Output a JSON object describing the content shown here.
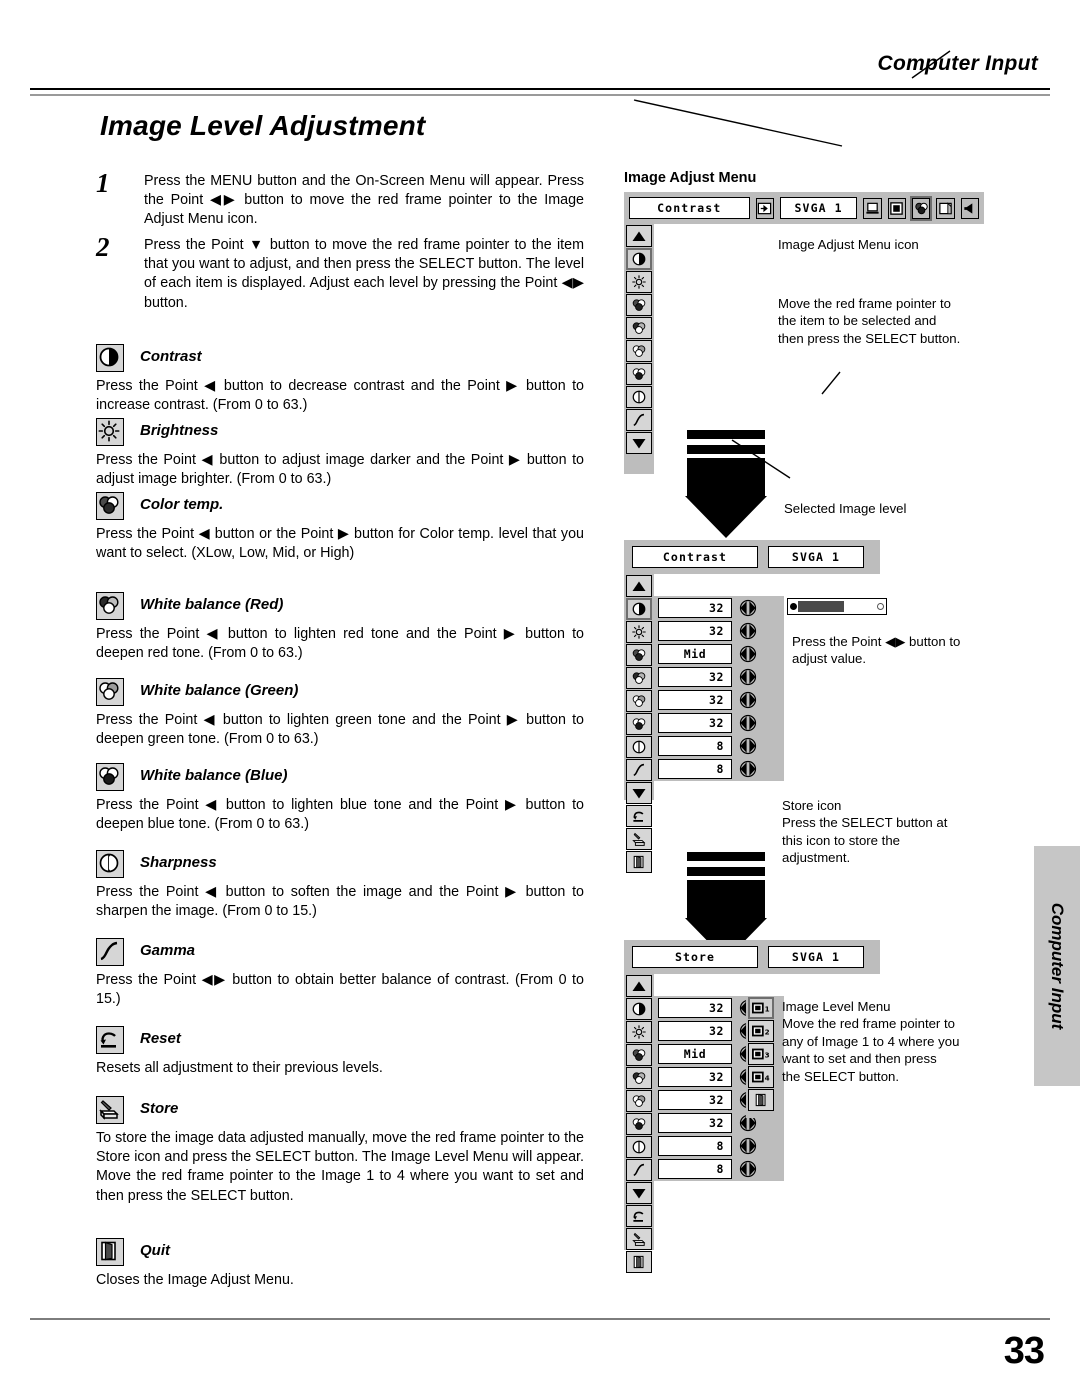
{
  "header": {
    "section_title": "Computer Input",
    "page_number": "33"
  },
  "side_tab": {
    "label": "Computer Input"
  },
  "page_title": "Image Level Adjustment",
  "steps": [
    {
      "number": "1",
      "text": "Press the MENU button and the On-Screen Menu will appear.  Press the Point ◀▶ button to move the red frame pointer to the Image Adjust Menu icon."
    },
    {
      "number": "2",
      "text": "Press the Point ▼ button to move the red frame pointer to the item that you want to adjust, and then press the SELECT button.  The level of each item is displayed.  Adjust each level by pressing the Point ◀▶ button."
    }
  ],
  "items": [
    {
      "icon": "contrast-icon",
      "label": "Contrast",
      "description": "Press the Point ◀ button to decrease contrast and the Point ▶ button to increase contrast.  (From 0 to 63.)"
    },
    {
      "icon": "brightness-icon",
      "label": "Brightness",
      "description": "Press the Point ◀ button to adjust image darker and the Point ▶ button to adjust image brighter.  (From 0 to 63.)"
    },
    {
      "icon": "color-temp-icon",
      "label": "Color temp.",
      "description": "Press the Point ◀ button or the Point ▶ button for Color temp. level that you want to select. (XLow, Low, Mid, or High)"
    },
    {
      "icon": "white-balance-red-icon",
      "label": "White balance (Red)",
      "description": "Press the Point ◀ button to lighten red tone and the Point ▶ button to deepen red tone.  (From 0 to 63.)"
    },
    {
      "icon": "white-balance-green-icon",
      "label": "White balance (Green)",
      "description": "Press the Point ◀ button to lighten green tone and the Point ▶ button to deepen green tone.  (From 0 to 63.)"
    },
    {
      "icon": "white-balance-blue-icon",
      "label": "White balance (Blue)",
      "description": "Press the Point ◀ button to lighten blue tone and the Point ▶ button to deepen blue tone.  (From 0 to 63.)"
    },
    {
      "icon": "sharpness-icon",
      "label": "Sharpness",
      "description": "Press the Point ◀ button to soften the image and the Point ▶ button to sharpen the image.  (From 0 to 15.)"
    },
    {
      "icon": "gamma-icon",
      "label": "Gamma",
      "description": "Press the Point ◀▶ button to obtain better balance of contrast. (From 0 to 15.)"
    },
    {
      "icon": "reset-icon",
      "label": "Reset",
      "description": "Resets all adjustment to their previous levels."
    },
    {
      "icon": "store-icon",
      "label": "Store",
      "description": "To store the image data adjusted manually, move the red frame pointer to the Store icon and press the SELECT button.  The Image Level Menu will appear.  Move the red frame pointer to the Image 1 to 4 where you want to set and then press the SELECT button."
    },
    {
      "icon": "quit-icon",
      "label": "Quit",
      "description": "Closes the Image Adjust Menu."
    }
  ],
  "diagram": {
    "title": "Image Adjust Menu",
    "menu1": {
      "title_field": "Contrast",
      "source_field": "SVGA 1",
      "toolbar_icons": [
        "input-icon",
        "computer-icon",
        "screen-icon",
        "image-adjust-icon",
        "pc-adjust-icon",
        "sound-icon"
      ],
      "selected_toolbar_icon": "image-adjust-icon",
      "icon_rows": [
        "scroll-up-icon",
        "contrast-icon",
        "brightness-icon",
        "color-temp-icon",
        "white-balance-red-icon",
        "white-balance-green-icon",
        "white-balance-blue-icon",
        "sharpness-icon",
        "gamma-icon",
        "scroll-down-icon"
      ],
      "highlighted_row": "contrast-icon",
      "callout_menu_icon": "Image Adjust Menu icon",
      "callout_pointer": "Move the red frame pointer to\nthe item to be selected and\nthen press the SELECT button."
    },
    "menu2": {
      "title_field": "Contrast",
      "source_field": "SVGA 1",
      "callout_level": "Selected Image level",
      "callout_adjust": "Press the Point ◀▶ button to\nadjust value.",
      "callout_store": "Store icon\nPress the SELECT button at\nthis icon to store the\nadjustment.",
      "slider": {
        "value_percent": 52
      },
      "rows": [
        {
          "icon": "contrast-icon",
          "value": "32",
          "centered": false
        },
        {
          "icon": "brightness-icon",
          "value": "32",
          "centered": false
        },
        {
          "icon": "color-temp-icon",
          "value": "Mid",
          "centered": true
        },
        {
          "icon": "white-balance-red-icon",
          "value": "32",
          "centered": false
        },
        {
          "icon": "white-balance-green-icon",
          "value": "32",
          "centered": false
        },
        {
          "icon": "white-balance-blue-icon",
          "value": "32",
          "centered": false
        },
        {
          "icon": "sharpness-icon",
          "value": "8",
          "centered": false
        },
        {
          "icon": "gamma-icon",
          "value": "8",
          "centered": false
        }
      ],
      "footer_icons": [
        "scroll-down-icon",
        "reset-icon",
        "store-icon",
        "quit-icon"
      ],
      "highlighted_row": "contrast-icon"
    },
    "menu3": {
      "title_field": "Store",
      "source_field": "SVGA 1",
      "callout_level_menu": "Image Level Menu\nMove the red frame pointer to\nany of Image 1 to 4 where you\nwant to set  and then press\nthe SELECT button.",
      "rows": [
        {
          "icon": "contrast-icon",
          "value": "32",
          "centered": false
        },
        {
          "icon": "brightness-icon",
          "value": "32",
          "centered": false
        },
        {
          "icon": "color-temp-icon",
          "value": "Mid",
          "centered": true
        },
        {
          "icon": "white-balance-red-icon",
          "value": "32",
          "centered": false
        },
        {
          "icon": "white-balance-green-icon",
          "value": "32",
          "centered": false
        },
        {
          "icon": "white-balance-blue-icon",
          "value": "32",
          "centered": false
        },
        {
          "icon": "sharpness-icon",
          "value": "8",
          "centered": false
        },
        {
          "icon": "gamma-icon",
          "value": "8",
          "centered": false
        }
      ],
      "level_icons": [
        "image-1-icon",
        "image-2-icon",
        "image-3-icon",
        "image-4-icon",
        "quit-icon"
      ],
      "level_labels": [
        "1",
        "2",
        "3",
        "4"
      ],
      "selected_level": "image-1-icon",
      "footer_icons": [
        "scroll-down-icon",
        "reset-icon",
        "store-icon",
        "quit-icon"
      ]
    }
  }
}
